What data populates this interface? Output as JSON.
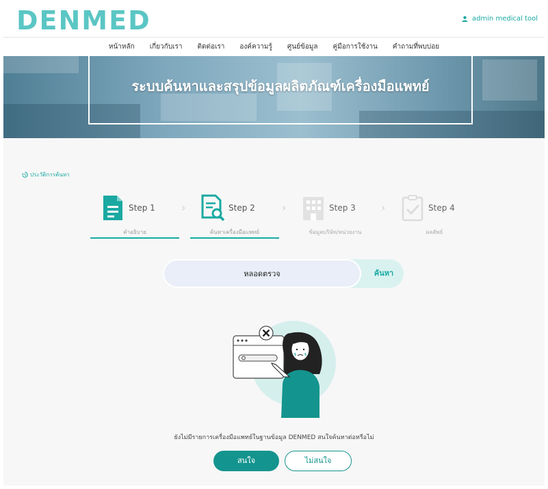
{
  "header": {
    "logo": "DENMED",
    "user_name": "admin medical tool"
  },
  "nav": {
    "items": [
      "หน้าหลัก",
      "เกี่ยวกับเรา",
      "ติดต่อเรา",
      "องค์ความรู้",
      "ศูนย์ข้อมูล",
      "คู่มือการใช้งาน",
      "คำถามที่พบบ่อย"
    ]
  },
  "hero": {
    "title": "ระบบค้นหาและสรุปข้อมูลผลิตภัณฑ์เครื่องมือแพทย์"
  },
  "history": {
    "label": "ประวัติการค้นหา"
  },
  "steps": [
    {
      "label": "Step 1",
      "sub": "คำอธิบาย",
      "icon": "document-icon",
      "state": "done"
    },
    {
      "label": "Step 2",
      "sub": "ค้นหาเครื่องมือแพทย์",
      "icon": "search-document-icon",
      "state": "active"
    },
    {
      "label": "Step 3",
      "sub": "ข้อมูลบริษัท/หน่วยงาน",
      "icon": "building-icon",
      "state": "disabled"
    },
    {
      "label": "Step 4",
      "sub": "ผลลัพธ์",
      "icon": "clipboard-check-icon",
      "state": "disabled"
    }
  ],
  "search": {
    "value": "หลอดตรวจ",
    "button_label": "ค้นหา"
  },
  "message": "ยังไม่มีรายการเครื่องมือแพทย์ในฐานข้อมูล DENMED สนใจค้นหาต่อหรือไม่",
  "actions": {
    "yes_label": "สนใจ",
    "no_label": "ไม่สนใจ"
  },
  "colors": {
    "accent": "#1aa9a2",
    "logo": "#5bc6c4",
    "button": "#14948e"
  }
}
